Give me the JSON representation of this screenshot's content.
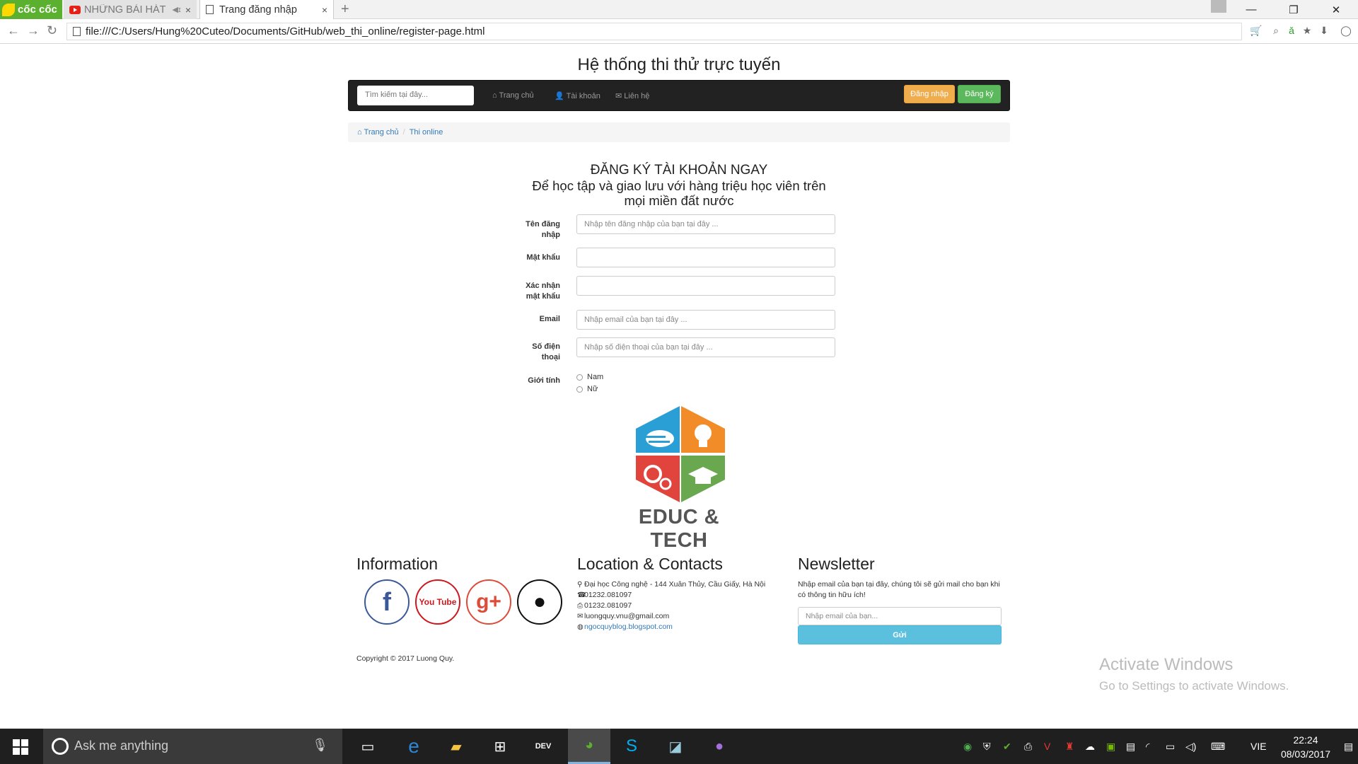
{
  "browser": {
    "brand": "cốc cốc",
    "tabs": [
      {
        "label": "NHỮNG BÀI HÁT",
        "active": false
      },
      {
        "label": "Trang đăng nhập",
        "active": true
      }
    ],
    "address": "file:///C:/Users/Hung%20Cuteo/Documents/GitHub/web_thi_online/register-page.html"
  },
  "site": {
    "title": "Hệ thống thi thử trực tuyến",
    "search_placeholder": "Tìm kiếm tại đây...",
    "nav": [
      "Trang chủ",
      "Tài khoản",
      "Liên hệ"
    ],
    "login_button": "Đăng nhập",
    "register_button": "Đăng ký",
    "breadcrumb": [
      "Trang chủ",
      "Thi online"
    ]
  },
  "form": {
    "heading": "ĐĂNG KÝ TÀI KHOẢN NGAY",
    "subheading_line1": "Để học tập và giao lưu với hàng triệu học viên trên",
    "subheading_line2": "mọi miền đất nước",
    "fields": [
      {
        "label_line1": "Tên đăng",
        "label_line2": "nhập",
        "placeholder": "Nhập tên đăng nhập của bạn tại đây ..."
      },
      {
        "label_line1": "Mật khẩu",
        "label_line2": "",
        "placeholder": ""
      },
      {
        "label_line1": "Xác nhận",
        "label_line2": "mật khẩu",
        "placeholder": ""
      },
      {
        "label_line1": "Email",
        "label_line2": "",
        "placeholder": "Nhập email của bạn tại đây ..."
      },
      {
        "label_line1": "Số điện",
        "label_line2": "thoại",
        "placeholder": "Nhập số điện thoại của bạn tại đây ..."
      }
    ],
    "gender_label": "Giới tính",
    "gender_options": [
      "Nam",
      "Nữ"
    ]
  },
  "logo": {
    "text": "EDUC & TECH",
    "colors": {
      "blue": "#2a9fd6",
      "orange": "#f28c28",
      "red": "#e0443c",
      "green": "#6aa84f"
    }
  },
  "footer": {
    "information_title": "Information",
    "social": [
      {
        "name": "facebook",
        "glyph": "f",
        "color": "#3b5998"
      },
      {
        "name": "youtube",
        "glyph": "You Tube",
        "color": "#cc181e"
      },
      {
        "name": "google-plus",
        "glyph": "g+",
        "color": "#dd4b39"
      },
      {
        "name": "github",
        "glyph": "●",
        "color": "#111111"
      }
    ],
    "location_title": "Location & Contacts",
    "contacts": {
      "address": "Đại học Công nghệ - 144 Xuân Thủy, Cầu Giấy, Hà Nội",
      "phone1": "01232.081097",
      "phone2": "01232.081097",
      "email": "luongquy.vnu@gmail.com",
      "website": "ngocquyblog.blogspot.com"
    },
    "newsletter_title": "Newsletter",
    "newsletter_text": "Nhập email của bạn tại đây, chúng tôi sẽ gửi mail cho bạn khi có thông tin hữu ích!",
    "newsletter_placeholder": "Nhập email của bạn...",
    "newsletter_button": "Gửi",
    "copyright": "Copyright © 2017 Luong Quy."
  },
  "watermark": {
    "line1": "Activate Windows",
    "line2": "Go to Settings to activate Windows."
  },
  "taskbar": {
    "search_text": "Ask me anything",
    "language": "VIE",
    "time": "22:24",
    "date": "08/03/2017"
  }
}
